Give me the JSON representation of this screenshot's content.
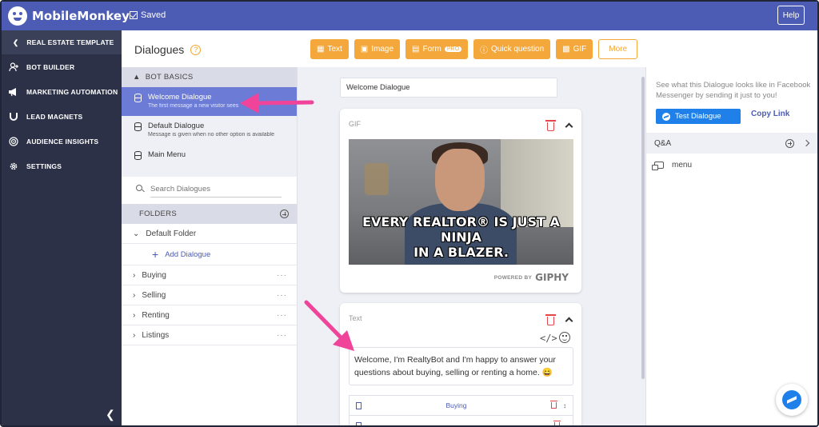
{
  "app": {
    "brand": "MobileMonkey",
    "saved_label": "Saved",
    "help_label": "Help"
  },
  "leftnav": {
    "template_label": "REAL ESTATE TEMPLATE",
    "items": [
      {
        "label": "BOT BUILDER",
        "icon": "add-user-icon"
      },
      {
        "label": "MARKETING AUTOMATION",
        "icon": "megaphone-icon"
      },
      {
        "label": "LEAD MAGNETS",
        "icon": "magnet-icon"
      },
      {
        "label": "AUDIENCE INSIGHTS",
        "icon": "target-icon"
      },
      {
        "label": "SETTINGS",
        "icon": "gear-icon"
      }
    ]
  },
  "header": {
    "title": "Dialogues",
    "help_glyph": "?",
    "toolbar": {
      "text": "Text",
      "image": "Image",
      "form": "Form",
      "form_badge": "PRO",
      "quick_question": "Quick question",
      "gif": "GIF",
      "more": "More"
    }
  },
  "listpanel": {
    "bot_basics_label": "BOT BASICS",
    "dialogues": [
      {
        "title": "Welcome Dialogue",
        "subtitle": "The first message a new visitor sees",
        "active": true
      },
      {
        "title": "Default Dialogue",
        "subtitle": "Message is given when no other option is available",
        "active": false
      },
      {
        "title": "Main Menu",
        "subtitle": "",
        "active": false
      }
    ],
    "search_placeholder": "Search Dialogues",
    "folders_label": "FOLDERS",
    "default_folder": "Default Folder",
    "add_dialogue": "Add Dialogue",
    "folders": [
      "Buying",
      "Selling",
      "Renting",
      "Listings"
    ],
    "row_menu": "···"
  },
  "canvas": {
    "dialogue_name": "Welcome Dialogue",
    "gif_card": {
      "label": "GIF",
      "caption_line1": "EVERY REALTOR® IS JUST A NINJA",
      "caption_line2": "IN A BLAZER.",
      "powered_by": "POWERED BY",
      "provider": "GIPHY"
    },
    "text_card": {
      "label": "Text",
      "code_glyph": "</>",
      "message": "Welcome, I'm RealtyBot and I'm happy to answer your questions about buying, selling or renting a home. 😄",
      "quick_replies": [
        "Buying",
        ""
      ]
    }
  },
  "rightpanel": {
    "description": "See what this Dialogue looks like in Facebook Messenger by sending it just to you!",
    "test_button": "Test Dialogue",
    "copy_link": "Copy Link",
    "qa_label": "Q&A",
    "qa_items": [
      "menu"
    ]
  },
  "colors": {
    "brand": "#4c5cb5",
    "sidebar": "#2c3147",
    "accent_orange": "#f4a73a",
    "active_item": "#6c7cd6",
    "messenger_blue": "#1e80e8",
    "annotation_arrow": "#f0449a"
  }
}
